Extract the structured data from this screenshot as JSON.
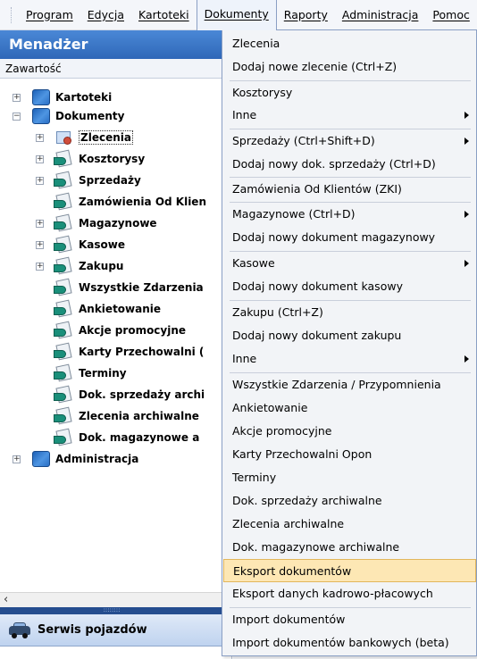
{
  "menubar": {
    "items": [
      "Program",
      "Edycja",
      "Kartoteki",
      "Dokumenty",
      "Raporty",
      "Administracja",
      "Pomoc"
    ],
    "active": "Dokumenty"
  },
  "panel": {
    "title": "Menadżer",
    "subtitle": "Zawartość",
    "tree": {
      "kartoteki": "Kartoteki",
      "dokumenty": "Dokumenty",
      "zlecenia": "Zlecenia",
      "kosztorysy": "Kosztorysy",
      "sprzedazy": "Sprzedaży",
      "zamowienia": "Zamówienia Od Klien",
      "magazynowe": "Magazynowe",
      "kasowe": "Kasowe",
      "zakupu": "Zakupu",
      "wszystkie": "Wszystkie Zdarzenia",
      "ankietowanie": "Ankietowanie",
      "akcje": "Akcje promocyjne",
      "karty": "Karty Przechowalni (",
      "terminy": "Terminy",
      "dok_sprzedazy": "Dok. sprzedaży archi",
      "zlecenia_arch": "Zlecenia archiwalne",
      "dok_magazynowe": "Dok. magazynowe a",
      "administracja": "Administracja"
    },
    "bottom_button": "Serwis pojazdów",
    "splitter_dots": "::::::::"
  },
  "dropdown": {
    "items": [
      {
        "label": "Zlecenia"
      },
      {
        "label": "Dodaj nowe zlecenie (Ctrl+Z)"
      },
      {
        "label": "Kosztorysy"
      },
      {
        "label": "Inne"
      },
      {
        "label": "Sprzedaży (Ctrl+Shift+D)"
      },
      {
        "label": "Dodaj nowy dok. sprzedaży (Ctrl+D)"
      },
      {
        "label": "Zamówienia Od Klientów (ZKI)"
      },
      {
        "label": "Magazynowe (Ctrl+D)"
      },
      {
        "label": "Dodaj nowy dokument magazynowy"
      },
      {
        "label": "Kasowe"
      },
      {
        "label": "Dodaj nowy dokument kasowy"
      },
      {
        "label": "Zakupu (Ctrl+Z)"
      },
      {
        "label": "Dodaj nowy dokument zakupu"
      },
      {
        "label": "Inne"
      },
      {
        "label": "Wszystkie Zdarzenia / Przypomnienia"
      },
      {
        "label": "Ankietowanie"
      },
      {
        "label": "Akcje promocyjne"
      },
      {
        "label": "Karty Przechowalni Opon"
      },
      {
        "label": "Terminy"
      },
      {
        "label": "Dok. sprzedaży archiwalne"
      },
      {
        "label": "Zlecenia archiwalne"
      },
      {
        "label": "Dok. magazynowe archiwalne"
      },
      {
        "label": "Eksport dokumentów"
      },
      {
        "label": "Eksport danych kadrowo-płacowych"
      },
      {
        "label": "Import dokumentów"
      },
      {
        "label": "Import dokumentów bankowych (beta)"
      }
    ]
  }
}
